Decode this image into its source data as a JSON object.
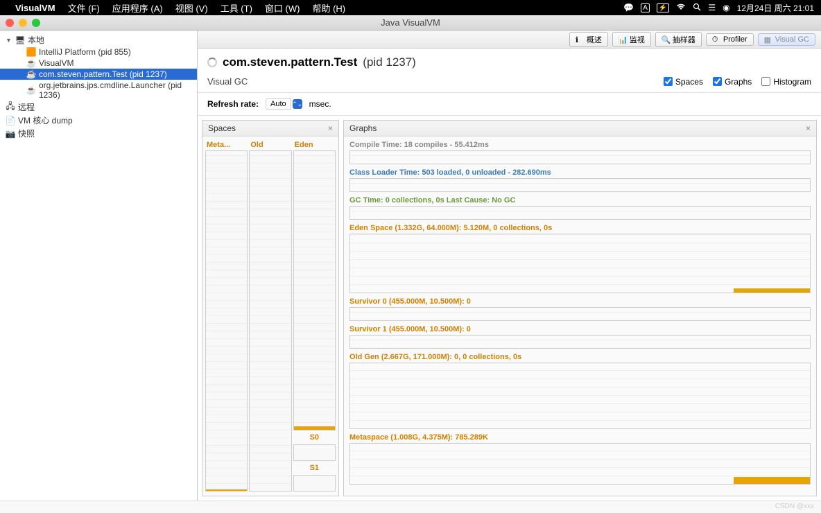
{
  "menubar": {
    "app": "VisualVM",
    "items": [
      "文件 (F)",
      "应用程序 (A)",
      "视图 (V)",
      "工具 (T)",
      "窗口 (W)",
      "帮助 (H)"
    ],
    "status_a": "A",
    "status_battery": "⚡",
    "datetime": "12月24日 周六 21:01"
  },
  "window": {
    "title": "Java VisualVM"
  },
  "tree": {
    "local": "本地",
    "items": [
      "IntelliJ Platform (pid 855)",
      "VisualVM",
      "com.steven.pattern.Test (pid 1237)",
      "org.jetbrains.jps.cmdline.Launcher (pid 1236)"
    ],
    "remote": "远程",
    "vmcore": "VM 核心 dump",
    "snapshot": "快照"
  },
  "tabs": {
    "overview": "概述",
    "monitor": "监视",
    "sampler": "抽样器",
    "profiler": "Profiler",
    "visualgc": "Visual GC"
  },
  "heading": {
    "title": "com.steven.pattern.Test",
    "pid": "(pid 1237)"
  },
  "subbar": {
    "tab": "Visual GC",
    "spaces": "Spaces",
    "graphs": "Graphs",
    "histogram": "Histogram"
  },
  "refresh": {
    "label": "Refresh rate:",
    "value": "Auto",
    "unit": "msec."
  },
  "spaces": {
    "header": "Spaces",
    "meta": "Meta...",
    "old": "Old",
    "eden": "Eden",
    "s0": "S0",
    "s1": "S1"
  },
  "graphs": {
    "header": "Graphs",
    "compile": "Compile Time: 18 compiles - 55.412ms",
    "classloader": "Class Loader Time: 503 loaded, 0 unloaded - 282.690ms",
    "gc": "GC Time: 0 collections, 0s Last Cause: No GC",
    "eden": "Eden Space (1.332G, 64.000M): 5.120M, 0 collections, 0s",
    "s0": "Survivor 0 (455.000M, 10.500M): 0",
    "s1": "Survivor 1 (455.000M, 10.500M): 0",
    "oldgen": "Old Gen (2.667G, 171.000M): 0, 0 collections, 0s",
    "metaspace": "Metaspace (1.008G, 4.375M): 785.289K"
  },
  "watermark": "CSDN @xxx"
}
